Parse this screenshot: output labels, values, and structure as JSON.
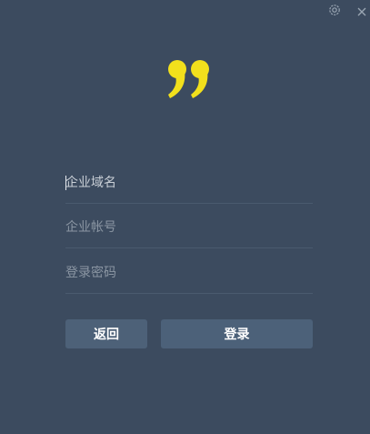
{
  "window": {
    "settings_icon": "gear-icon",
    "close_icon": "close-icon",
    "close_glyph": "×"
  },
  "logo": {
    "icon": "quote-mark-logo",
    "color": "#f2e01c"
  },
  "form": {
    "domain_placeholder": "企业域名",
    "account_placeholder": "企业帐号",
    "password_placeholder": "登录密码"
  },
  "buttons": {
    "back_label": "返回",
    "login_label": "登录"
  },
  "colors": {
    "background": "#3c4b5f",
    "button": "#4c6179",
    "divider": "#4a5a6e"
  }
}
